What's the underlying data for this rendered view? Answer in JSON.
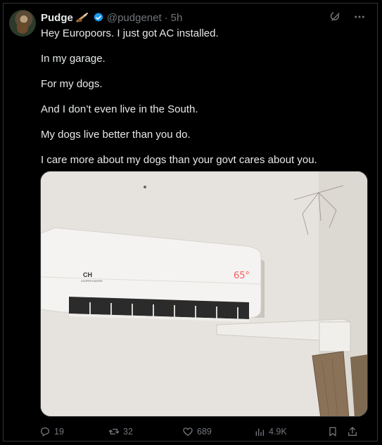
{
  "author": {
    "name": "Pudge",
    "handle": "@pudgenet",
    "separator": "·",
    "time": "5h"
  },
  "tweet": {
    "lines": [
      "Hey Europoors. I just got AC installed.",
      "In my garage.",
      "For my dogs.",
      "And I don’t even live in the South.",
      "My dogs live better than you do.",
      "I care more about my dogs than your govt cares about you."
    ]
  },
  "media": {
    "ac_brand": "CH",
    "ac_brand_sub": "COOPER HUNTER",
    "ac_display": "65°"
  },
  "actions": {
    "replies": "19",
    "reposts": "32",
    "likes": "689",
    "views": "4.9K"
  },
  "colors": {
    "background": "#000000",
    "text": "#e7e9ea",
    "muted": "#71767b",
    "verified": "#1d9bf0",
    "border": "#2f3336"
  },
  "icons": [
    "grok-icon",
    "more-icon",
    "reply-icon",
    "repost-icon",
    "like-icon",
    "views-icon",
    "bookmark-icon",
    "share-icon",
    "verified-badge-icon"
  ]
}
